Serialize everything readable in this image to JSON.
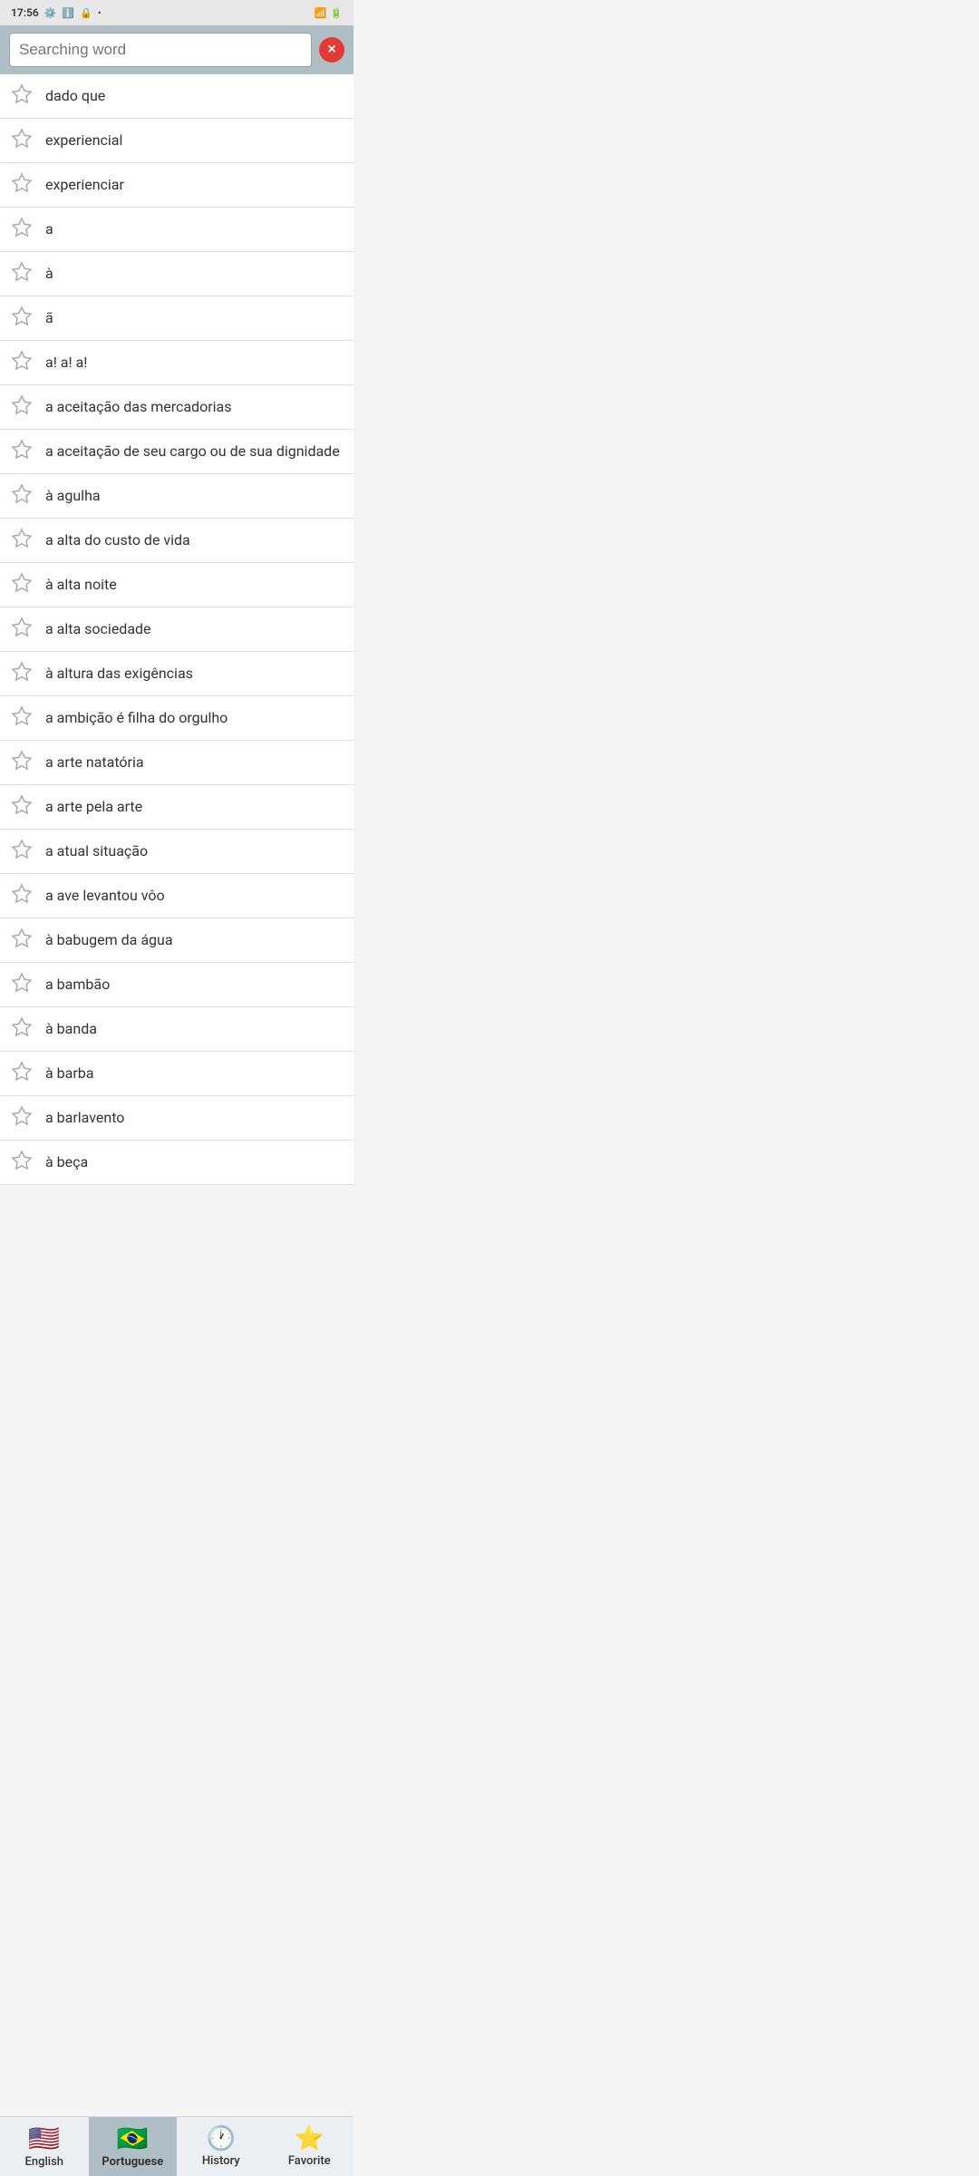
{
  "statusBar": {
    "time": "17:56",
    "icons": [
      "settings",
      "info",
      "security",
      "dot",
      "wifi",
      "battery"
    ]
  },
  "searchBar": {
    "placeholder": "Searching word",
    "clearLabel": "×"
  },
  "wordList": [
    {
      "id": 1,
      "text": "dado que",
      "favorited": false
    },
    {
      "id": 2,
      "text": " experiencial",
      "favorited": false
    },
    {
      "id": 3,
      "text": " experienciar",
      "favorited": false
    },
    {
      "id": 4,
      "text": "a",
      "favorited": false
    },
    {
      "id": 5,
      "text": "à",
      "favorited": false
    },
    {
      "id": 6,
      "text": "ã",
      "favorited": false
    },
    {
      "id": 7,
      "text": "a! a! a!",
      "favorited": false
    },
    {
      "id": 8,
      "text": "a aceitação das mercadorias",
      "favorited": false
    },
    {
      "id": 9,
      "text": "a aceitação de seu cargo ou de sua dignidade",
      "favorited": false
    },
    {
      "id": 10,
      "text": "à agulha",
      "favorited": false
    },
    {
      "id": 11,
      "text": "a alta do custo de vida",
      "favorited": false
    },
    {
      "id": 12,
      "text": "à alta noite",
      "favorited": false
    },
    {
      "id": 13,
      "text": "a alta sociedade",
      "favorited": false
    },
    {
      "id": 14,
      "text": "à altura das exigências",
      "favorited": false
    },
    {
      "id": 15,
      "text": "a ambição é filha do orgulho",
      "favorited": false
    },
    {
      "id": 16,
      "text": "a arte natatória",
      "favorited": false
    },
    {
      "id": 17,
      "text": "a arte pela arte",
      "favorited": false
    },
    {
      "id": 18,
      "text": "a atual situação",
      "favorited": false
    },
    {
      "id": 19,
      "text": "a ave levantou vôo",
      "favorited": false
    },
    {
      "id": 20,
      "text": "à babugem da água",
      "favorited": false
    },
    {
      "id": 21,
      "text": "a bambão",
      "favorited": false
    },
    {
      "id": 22,
      "text": "à banda",
      "favorited": false
    },
    {
      "id": 23,
      "text": "à barba",
      "favorited": false
    },
    {
      "id": 24,
      "text": "a barlavento",
      "favorited": false
    },
    {
      "id": 25,
      "text": "à beça",
      "favorited": false
    }
  ],
  "bottomNav": {
    "items": [
      {
        "id": "english",
        "label": "English",
        "type": "flag",
        "flag": "🇺🇸",
        "active": false
      },
      {
        "id": "portuguese",
        "label": "Portuguese",
        "type": "flag",
        "flag": "🇧🇷",
        "active": true
      },
      {
        "id": "history",
        "label": "History",
        "type": "icon",
        "icon": "🕐",
        "active": false
      },
      {
        "id": "favorite",
        "label": "Favorite",
        "type": "icon",
        "icon": "⭐",
        "active": false
      }
    ]
  }
}
